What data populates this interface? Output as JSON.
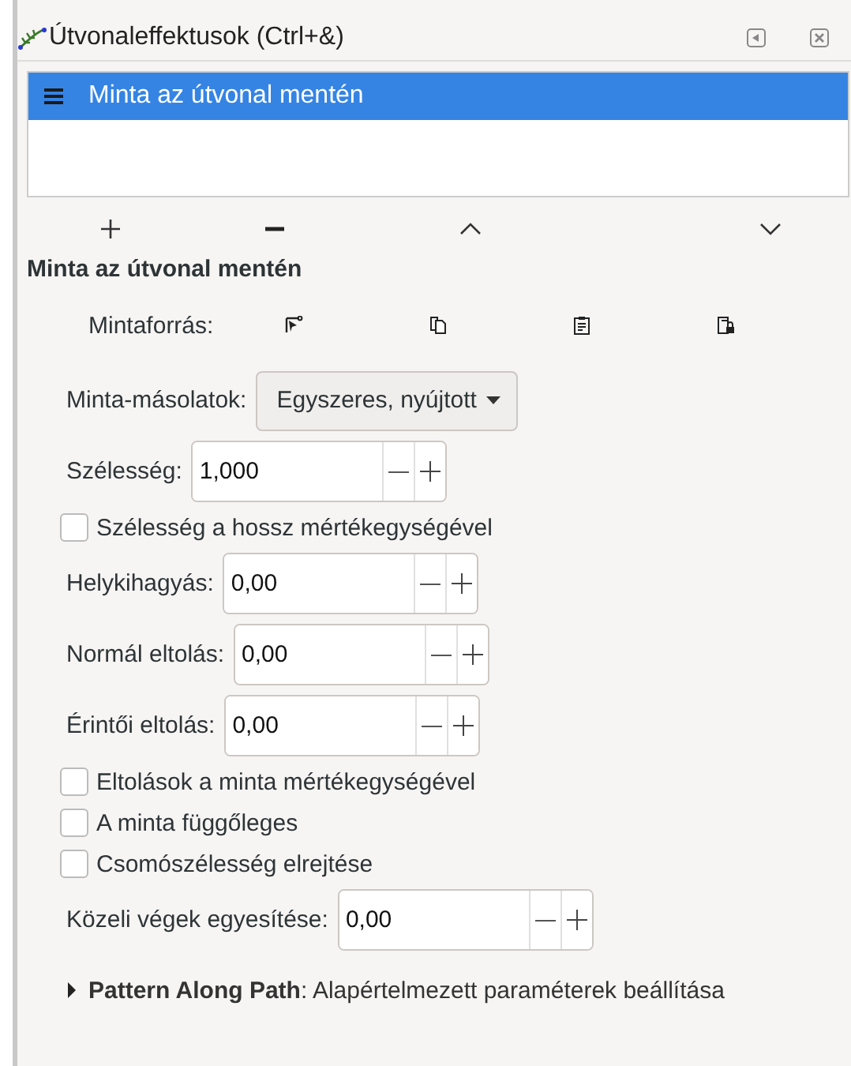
{
  "panel": {
    "title": "Útvonaleffektusok (Ctrl+&)"
  },
  "effects": [
    {
      "label": "Minta az útvonal mentén",
      "selected": true
    }
  ],
  "section_title": "Minta az útvonal mentén",
  "source": {
    "label": "Mintaforrás:"
  },
  "params": [
    {
      "kind": "select",
      "label": "Minta-másolatok:",
      "value": "Egyszeres, nyújtott"
    },
    {
      "kind": "spin",
      "label": "Szélesség:",
      "value": "1,000"
    },
    {
      "kind": "check",
      "label": "Szélesség a hossz mértékegységével",
      "checked": false
    },
    {
      "kind": "spin",
      "label": "Helykihagyás:",
      "value": "0,00"
    },
    {
      "kind": "spin",
      "label": "Normál eltolás:",
      "value": "0,00"
    },
    {
      "kind": "spin",
      "label": "Érintői eltolás:",
      "value": "0,00"
    },
    {
      "kind": "check",
      "label": "Eltolások a minta mértékegységével",
      "checked": false
    },
    {
      "kind": "check",
      "label": "A minta függőleges",
      "checked": false
    },
    {
      "kind": "check",
      "label": "Csomószélesség elrejtése",
      "checked": false
    },
    {
      "kind": "spin",
      "label": "Közeli végek egyesítése:",
      "value": "0,00"
    }
  ],
  "defaults": {
    "text": "**Pattern Along Path**: Alapértelmezett paraméterek beállítása",
    "expanded": false
  }
}
